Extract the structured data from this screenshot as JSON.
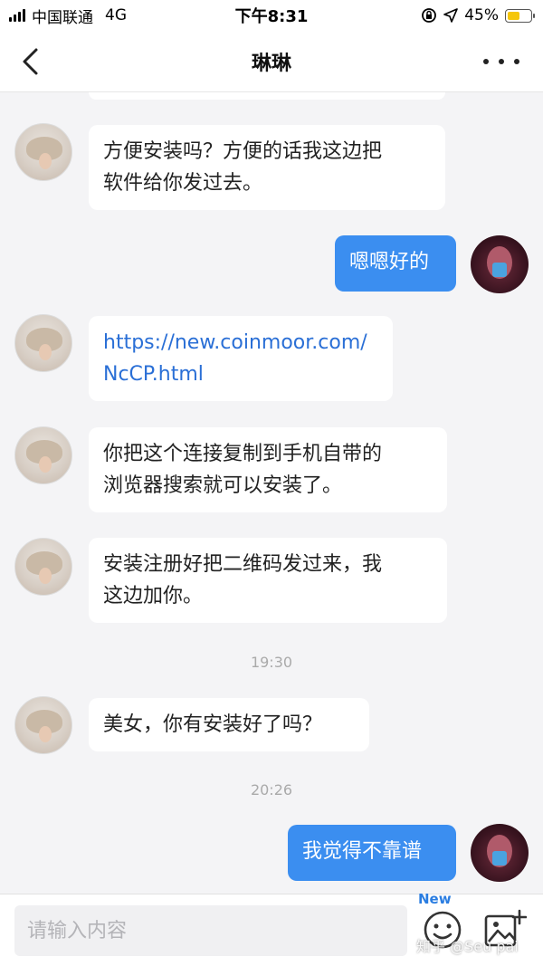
{
  "status_bar": {
    "carrier": "中国联通",
    "network": "4G",
    "time": "下午8:31",
    "battery": "45%"
  },
  "nav": {
    "title": "琳琳"
  },
  "messages": [
    {
      "side": "left",
      "text": "方便安装吗？方便的话我这边把\n软件给你发过去。"
    },
    {
      "side": "right",
      "text": "嗯嗯好的"
    },
    {
      "side": "left",
      "text": "https://new.coinmoor.com/\nNcCP.html",
      "link": true
    },
    {
      "side": "left",
      "text": "你把这个连接复制到手机自带的\n浏览器搜索就可以安装了。"
    },
    {
      "side": "left",
      "text": "安装注册好把二维码发过来，我\n这边加你。"
    },
    {
      "side": "left",
      "text": "美女，你有安装好了吗？"
    },
    {
      "side": "right",
      "text": "我觉得不靠谱"
    }
  ],
  "timestamps": [
    "19:30",
    "20:26"
  ],
  "input": {
    "placeholder": "请输入内容",
    "new_badge": "New"
  },
  "watermark": "知乎 @Seu pai",
  "colors": {
    "accent": "#3b8ef0",
    "link": "#2a6fd6"
  }
}
